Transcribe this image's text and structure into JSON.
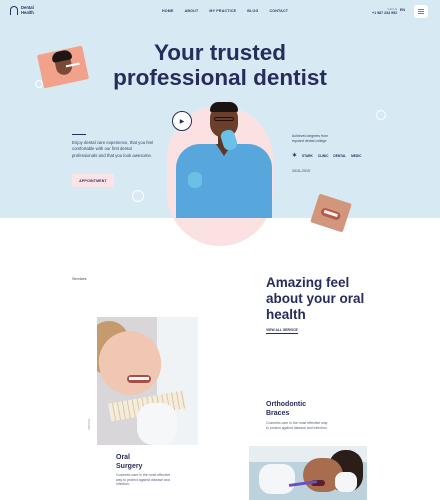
{
  "header": {
    "logo_line1": "Dental",
    "logo_line2": "Health",
    "nav": [
      "HOME",
      "ABOUT",
      "MY PRACTICE",
      "BLOG",
      "CONTACT"
    ],
    "call_label": "Call Us",
    "call_number": "+1 987 234 992",
    "lang": "EN"
  },
  "hero": {
    "title_line1": "Your trusted",
    "title_line2": "professional dentist",
    "text": "Enjoy dental care experience, that you feel comfortable with our first dental professionals and that you look awesome.",
    "cta_label": "APPOINTMENT",
    "award_text": "Achieved degrees from reputed dental college",
    "award_logos": [
      "STARK",
      "CLINIC",
      "DENTAL",
      "MEDIC"
    ],
    "years": "2015–2019"
  },
  "services": {
    "label": "Services",
    "title": "Amazing feel about your oral health",
    "view_all": "VIEW ALL SERVICE",
    "card1": {
      "vertical_label": "DENTAL",
      "title_line1": "Oral",
      "title_line2": "Surgery",
      "desc": "Cosmetic care is the most effective way to protect against disease and infection."
    },
    "card2": {
      "title_line1": "Orthodontic",
      "title_line2": "Braces",
      "desc": "Cosmetic care is the most effective way to protect against disease and infection."
    }
  },
  "colors": {
    "hero_bg": "#d7eaf3",
    "navy": "#262c5c",
    "pink": "#fce3e5",
    "accent_red": "#e2564b",
    "scrub_blue": "#58a7dc"
  },
  "icons": [
    "logo-tooth-icon",
    "menu-icon",
    "play-icon"
  ]
}
